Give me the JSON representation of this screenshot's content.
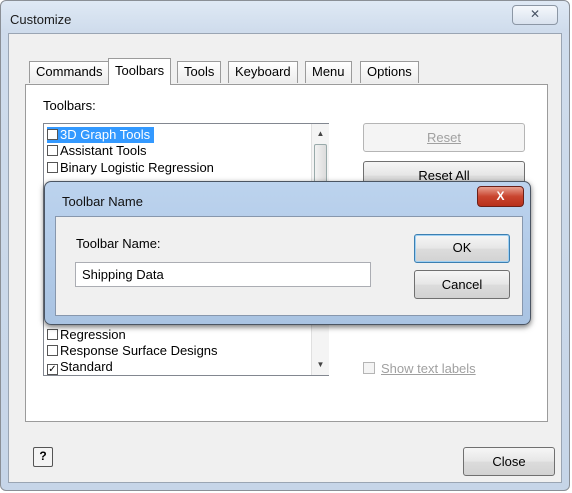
{
  "window": {
    "title": "Customize",
    "close_glyph": "✕"
  },
  "tabs": [
    {
      "label": "Commands",
      "active": false
    },
    {
      "label": "Toolbars",
      "active": true
    },
    {
      "label": "Tools",
      "active": false
    },
    {
      "label": "Keyboard",
      "active": false
    },
    {
      "label": "Menu",
      "active": false
    },
    {
      "label": "Options",
      "active": false
    }
  ],
  "toolbars_label": "Toolbars:",
  "list_items": [
    {
      "label": "3D Graph Tools",
      "checked": false,
      "selected": true
    },
    {
      "label": "Assistant Tools",
      "checked": false,
      "selected": false
    },
    {
      "label": "Binary Logistic Regression",
      "checked": false,
      "selected": false
    },
    {
      "label": "Regression",
      "checked": false,
      "selected": false
    },
    {
      "label": "Response Surface Designs",
      "checked": false,
      "selected": false
    },
    {
      "label": "Standard",
      "checked": true,
      "selected": false
    }
  ],
  "buttons": {
    "reset": "Reset",
    "reset_all": "Reset All",
    "close": "Close",
    "help": "?"
  },
  "show_text_labels": {
    "label": "Show text labels",
    "checked": false,
    "enabled": false
  },
  "dialog": {
    "title": "Toolbar Name",
    "close_glyph": "X",
    "field_label": "Toolbar Name:",
    "field_value": "Shipping Data",
    "ok": "OK",
    "cancel": "Cancel"
  },
  "icons": [
    "close-icon",
    "help-icon",
    "scroll-up-icon",
    "scroll-down-icon",
    "checkbox-icon"
  ]
}
